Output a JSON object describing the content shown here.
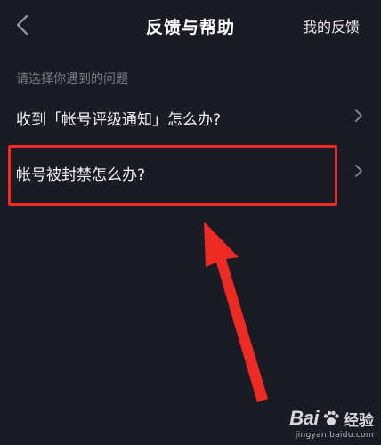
{
  "header": {
    "title": "反馈与帮助",
    "right_action": "我的反馈"
  },
  "section": {
    "label": "请选择你遇到的问题"
  },
  "items": [
    {
      "label": "收到「帐号评级通知」怎么办?"
    },
    {
      "label": "帐号被封禁怎么办?"
    }
  ],
  "annotation": {
    "highlight_color": "#ee2a25"
  },
  "watermark": {
    "brand": "Bai",
    "suffix": "经验",
    "url": "jingyan.baidu.com"
  },
  "icons": [
    "back-chevron-icon",
    "chevron-right-icon",
    "paw-icon"
  ]
}
